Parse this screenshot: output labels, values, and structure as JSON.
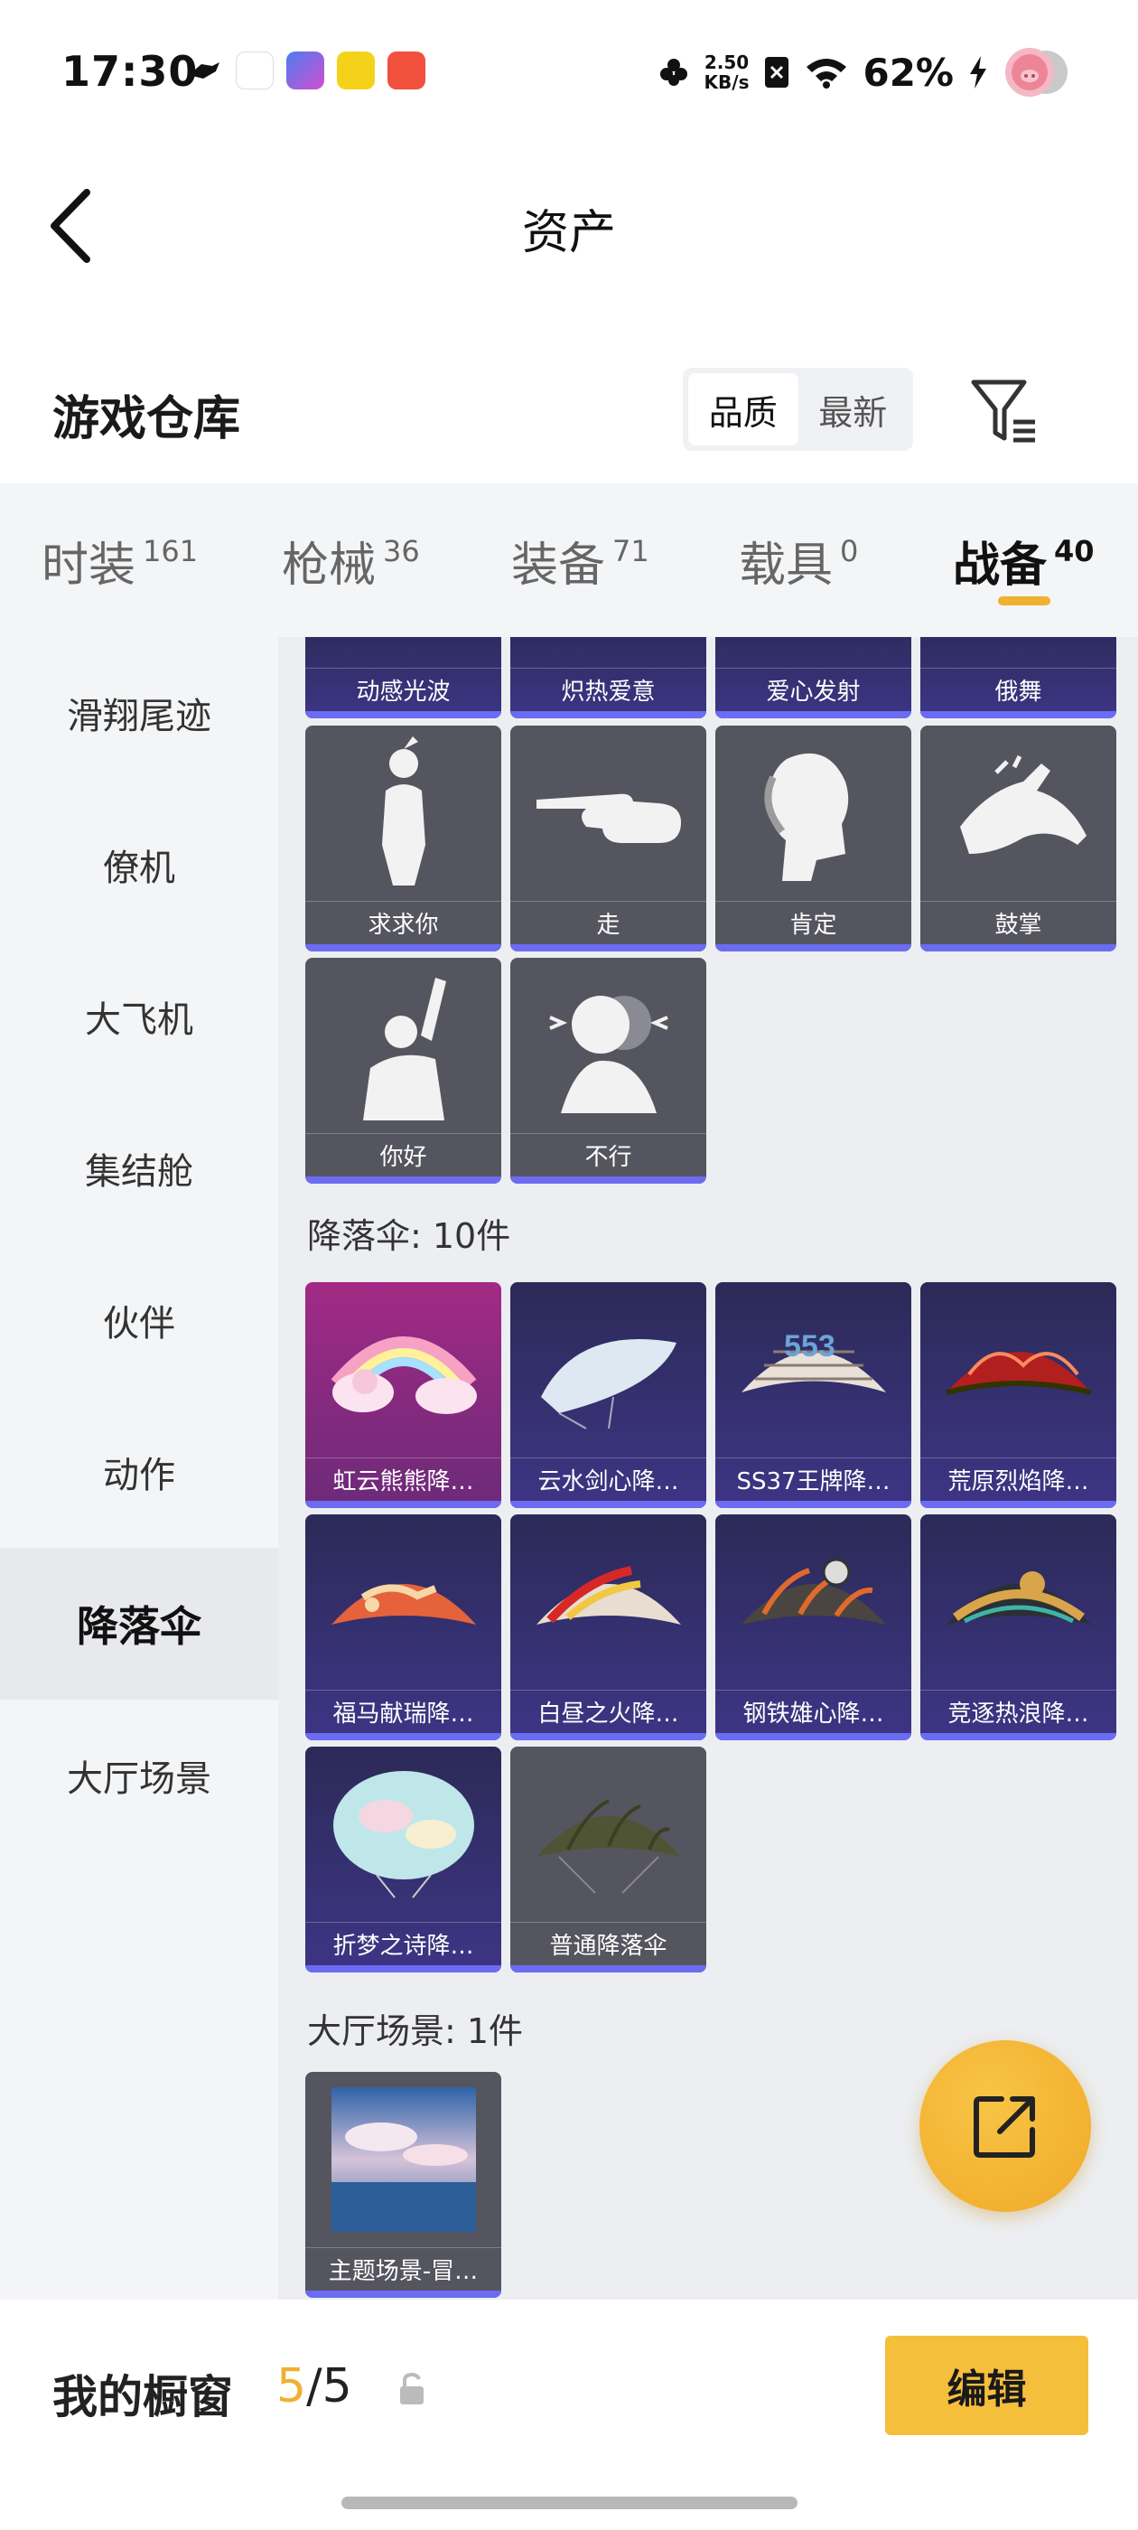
{
  "status_bar": {
    "time": "17:30",
    "net_speed_value": "2.50",
    "net_speed_unit": "KB/s",
    "battery": "62%",
    "app_icons": [
      "speed-boat-icon",
      "calendar-icon",
      "game-icon",
      "notes-icon",
      "video-icon"
    ]
  },
  "header": {
    "title": "资产"
  },
  "subheader": {
    "title": "游戏仓库",
    "sort_options": [
      "品质",
      "最新"
    ],
    "active_sort": "品质"
  },
  "tabs": [
    {
      "label": "时装",
      "count": "161"
    },
    {
      "label": "枪械",
      "count": "36"
    },
    {
      "label": "装备",
      "count": "71"
    },
    {
      "label": "载具",
      "count": "0"
    },
    {
      "label": "战备",
      "count": "40",
      "active": true
    }
  ],
  "sidebar": {
    "items": [
      "滑翔尾迹",
      "僚机",
      "大飞机",
      "集结舱",
      "伙伴",
      "动作",
      "降落伞",
      "大厅场景"
    ],
    "active": "降落伞"
  },
  "content": {
    "partial_row": [
      "动感光波",
      "炽热爱意",
      "爱心发射",
      "俄舞"
    ],
    "action_row1": [
      "求求你",
      "走",
      "肯定",
      "鼓掌"
    ],
    "action_row2": [
      "你好",
      "不行"
    ],
    "parachute_title": "降落伞: 10件",
    "parachutes": [
      "虹云熊熊降…",
      "云水剑心降…",
      "SS37王牌降…",
      "荒原烈焰降…",
      "福马献瑞降…",
      "白昼之火降…",
      "钢铁雄心降…",
      "竞逐热浪降…",
      "折梦之诗降…",
      "普通降落伞"
    ],
    "lobby_title": "大厅场景: 1件",
    "lobby_items": [
      "主题场景-冒…"
    ]
  },
  "bottom": {
    "showcase_label": "我的橱窗",
    "showcase_current": "5",
    "showcase_sep": "/",
    "showcase_total": "5",
    "edit_label": "编辑"
  },
  "colors": {
    "accent": "#f5bf3c",
    "purple_card": "#3d3585",
    "pink_card": "#a22a85",
    "grey_card": "#55555f",
    "rarity_bar": "#6b6cf2"
  }
}
